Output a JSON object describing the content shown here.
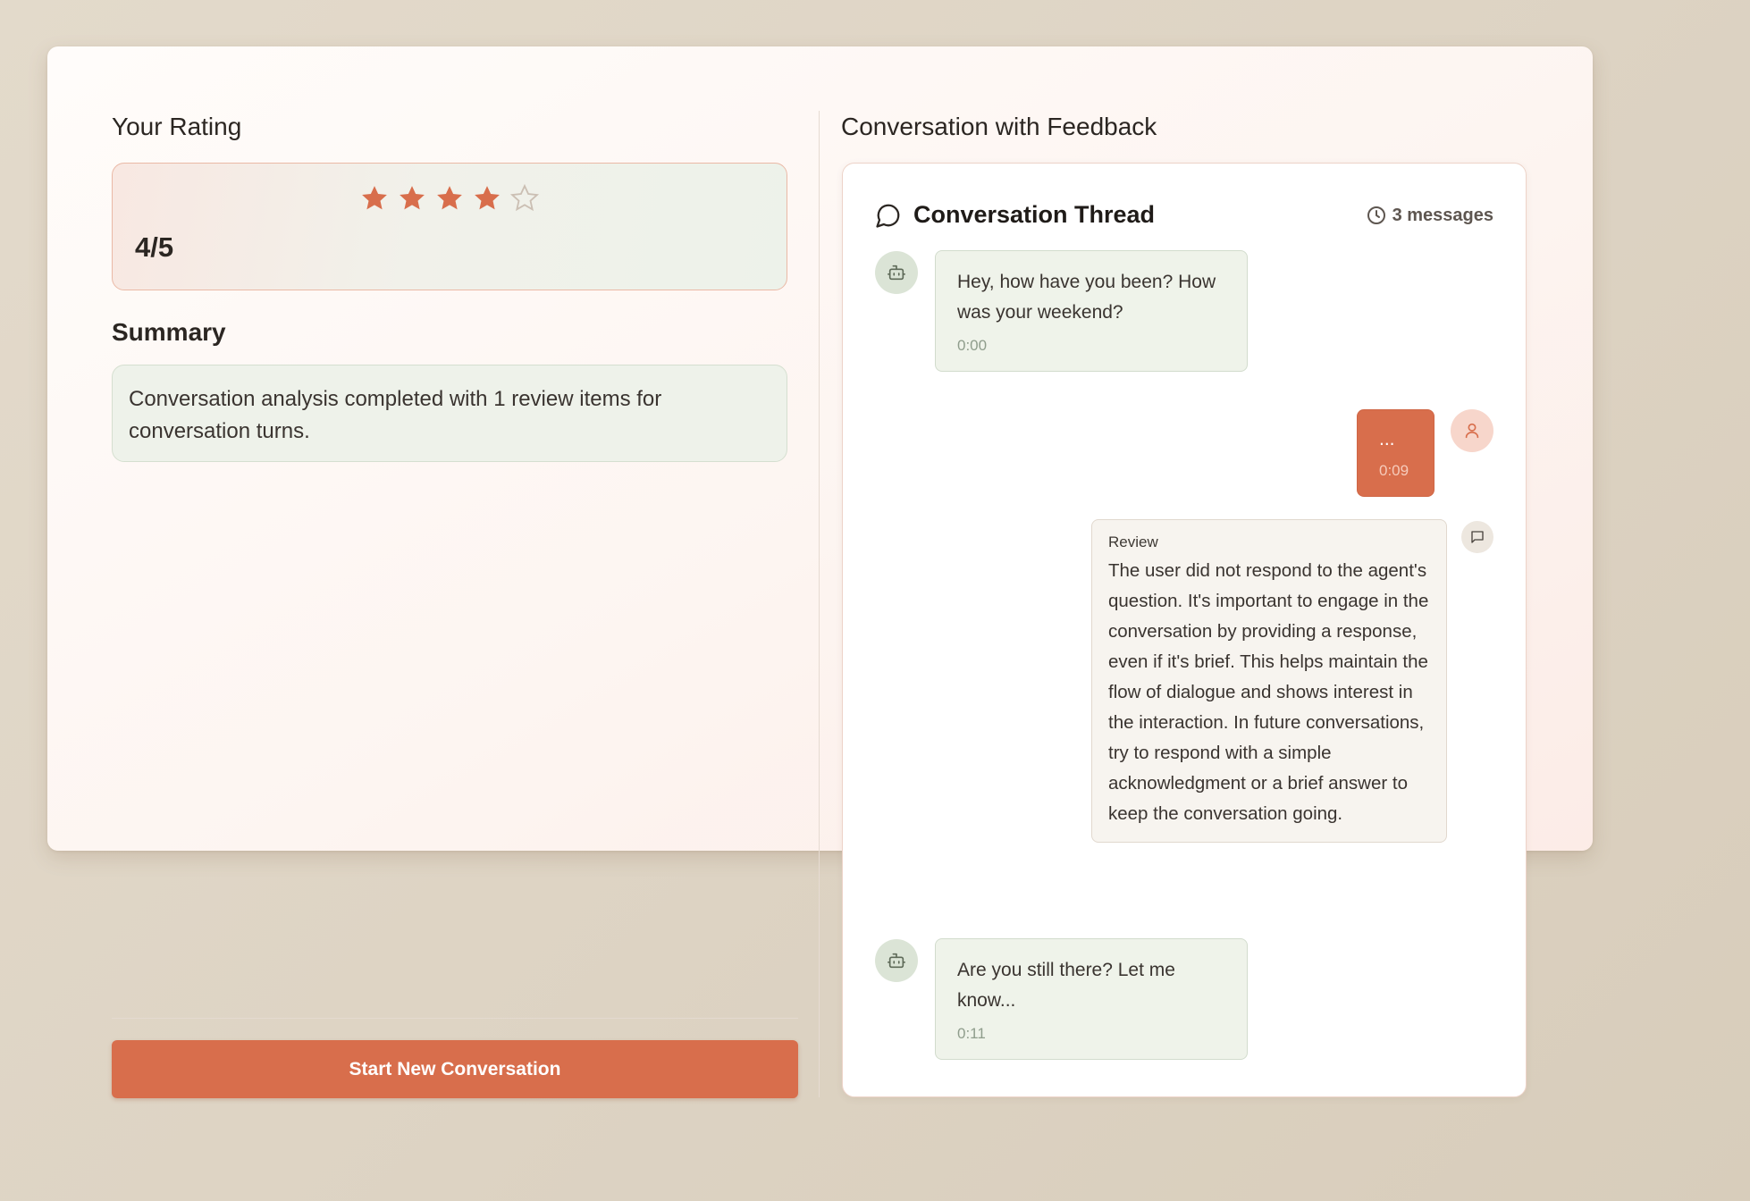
{
  "left_panel": {
    "rating_title": "Your Rating",
    "rating": {
      "value": 4,
      "max": 5,
      "display": "4/5"
    },
    "summary_title": "Summary",
    "summary_text": "Conversation analysis completed with 1 review items for conversation turns.",
    "start_button_label": "Start New Conversation"
  },
  "right_panel": {
    "title": "Conversation with Feedback",
    "thread": {
      "title": "Conversation Thread",
      "message_count": "3 messages",
      "messages": [
        {
          "role": "bot",
          "text": "Hey, how have you been? How was your weekend?",
          "time": "0:00"
        },
        {
          "role": "user",
          "text": "...",
          "time": "0:09"
        },
        {
          "role": "review",
          "label": "Review",
          "text": "The user did not respond to the agent's question. It's important to engage in the conversation by providing a response, even if it's brief. This helps maintain the flow of dialogue and shows interest in the interaction. In future conversations, try to respond with a simple acknowledgment or a brief answer to keep the conversation going."
        },
        {
          "role": "bot",
          "text": "Are you still there? Let me know...",
          "time": "0:11"
        }
      ]
    }
  },
  "icons": {
    "star_filled": "star-icon",
    "star_empty": "star-outline-icon",
    "thread": "chat-bubble-icon",
    "clock": "clock-icon",
    "bot": "bot-icon",
    "user": "user-icon",
    "review": "comment-icon"
  },
  "colors": {
    "accent": "#d86e4c",
    "bot_bubble": "#eff3ea",
    "background": "#e0d7c8"
  }
}
